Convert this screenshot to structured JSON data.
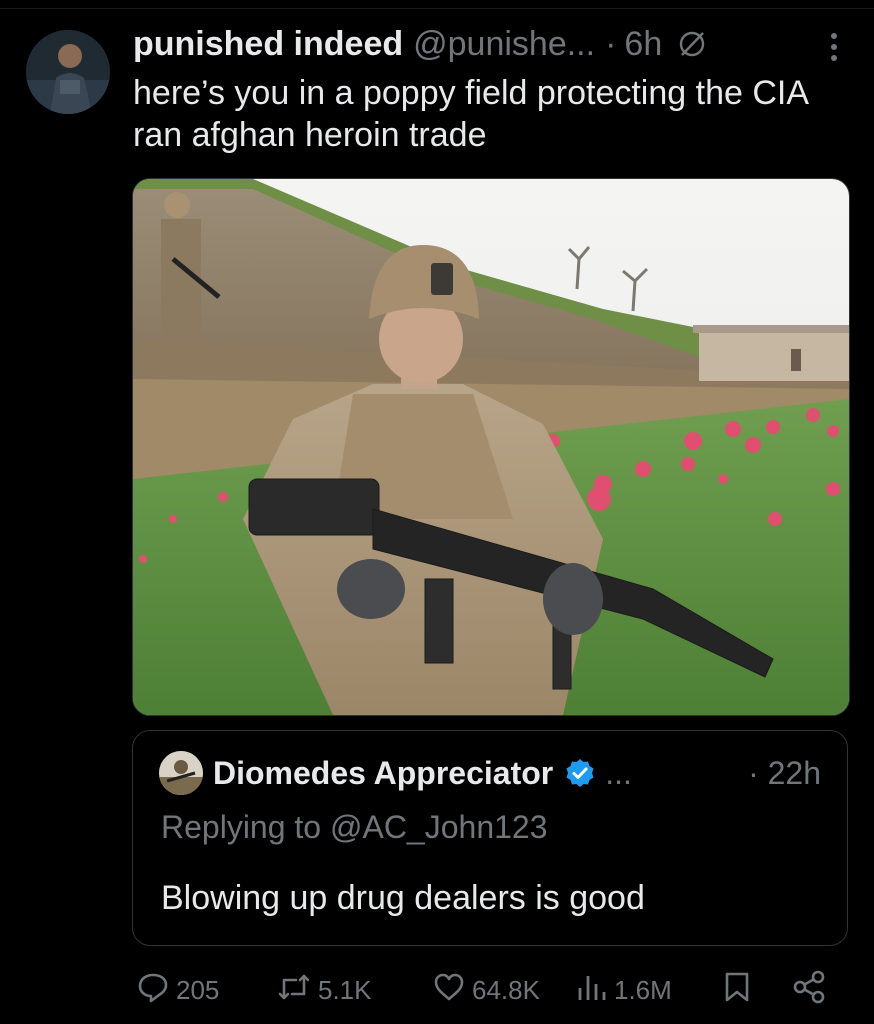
{
  "tweet": {
    "display_name": "punished indeed",
    "handle": "@punishe...",
    "dot": "·",
    "time": "6h",
    "text": "here’s you in a poppy field protecting the CIA ran afghan heroin trade"
  },
  "quote": {
    "display_name": "Diomedes Appreciator",
    "ellipsis": "...",
    "time": "· 22h",
    "replying": "Replying to @AC_John123",
    "text": "Blowing up drug dealers is good"
  },
  "actions": {
    "replies": "205",
    "reposts": "5.1K",
    "likes": "64.8K",
    "views": "1.6M"
  },
  "colors": {
    "background": "#000000",
    "text": "#e7e9ea",
    "muted": "#71767b",
    "verified": "#1d9bf0",
    "border": "#2f3336"
  },
  "icons": [
    "mute-icon",
    "more-icon",
    "verified-icon",
    "reply-icon",
    "repost-icon",
    "like-icon",
    "views-icon",
    "bookmark-icon",
    "share-icon"
  ]
}
